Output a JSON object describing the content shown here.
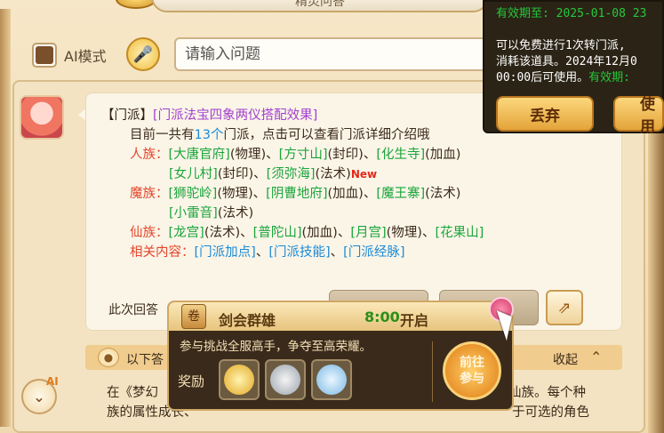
{
  "header": {
    "title": "精灵问答"
  },
  "ai_mode": {
    "label": "AI模式",
    "checked": true
  },
  "search": {
    "placeholder": "请输入问题"
  },
  "message": {
    "line1": {
      "tag": "【门派】",
      "link": "[门派法宝四象两仪搭配效果]"
    },
    "line2": {
      "pre": "目前一共有",
      "count": "13个",
      "post": "门派，点击可以查看门派详细介绍哦"
    },
    "human": {
      "label": "人族：",
      "row1": [
        {
          "name": "[大唐官府]",
          "note": "(物理)"
        },
        {
          "name": "[方寸山]",
          "note": "(封印)"
        },
        {
          "name": "[化生寺]",
          "note": "(加血)"
        }
      ],
      "row2": [
        {
          "name": "[女儿村]",
          "note": "(封印)"
        },
        {
          "name": "[须弥海]",
          "note": "(法术)"
        }
      ],
      "new_tag": "New"
    },
    "demon": {
      "label": "魔族：",
      "row1": [
        {
          "name": "[狮驼岭]",
          "note": "(物理)"
        },
        {
          "name": "[阴曹地府]",
          "note": "(加血)"
        },
        {
          "name": "[魔王寨]",
          "note": "(法术)"
        }
      ],
      "row2": [
        {
          "name": "[小雷音]",
          "note": "(法术)"
        }
      ]
    },
    "immortal": {
      "label": "仙族：",
      "row1": [
        {
          "name": "[龙宫]",
          "note": "(法术)"
        },
        {
          "name": "[普陀山]",
          "note": "(加血)"
        },
        {
          "name": "[月宫]",
          "note": "(物理)"
        },
        {
          "name": "[花果山]",
          "note": ""
        }
      ]
    },
    "related": {
      "label": "相关内容：",
      "items": [
        "[门派加点]",
        "[门派技能]",
        "[门派经脉]"
      ]
    },
    "separator": "、"
  },
  "answer_label": "此次回答",
  "section": {
    "title": "以下答",
    "collapse_label": "收起"
  },
  "detail": {
    "line1": "在《梦幻",
    "line2": "族的属性成长、",
    "right1": "仙族。每个种",
    "right2": "于可选的角色"
  },
  "ai_badge": "AI",
  "tooltip": {
    "line1": "有效期至: 2025-01-08 23",
    "line2": "可以免费进行1次转门派,",
    "line3": "消耗该道具。2024年12月0",
    "line4a": "00:00后可使用。",
    "line4b": "有效期:",
    "discard_label": "丢弃",
    "use_label": "使用"
  },
  "event": {
    "title": "剑会群雄",
    "time": "8:00",
    "time_suffix": "开启",
    "description": "参与挑战全服高手，争夺至高荣耀。",
    "reward_label": "奖励",
    "goto_line1": "前往",
    "goto_line2": "参与"
  },
  "colors": {
    "accent_gold": "#f0bd3d",
    "link_green": "#19a53a",
    "link_blue": "#1a8ad6",
    "race_red": "#e3452a",
    "topic_purple": "#a13fd0"
  }
}
